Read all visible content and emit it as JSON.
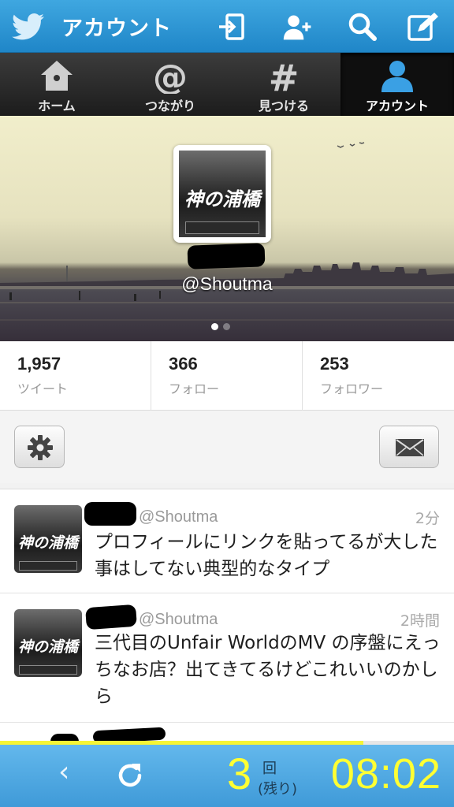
{
  "header": {
    "title": "アカウント",
    "icons": [
      "twitter-bird-icon",
      "sign-in-icon",
      "add-user-icon",
      "search-icon",
      "compose-icon"
    ]
  },
  "tabs": [
    {
      "label": "ホーム",
      "icon": "home-icon",
      "active": false
    },
    {
      "label": "つながり",
      "icon": "at-icon",
      "active": false
    },
    {
      "label": "見つける",
      "icon": "hash-icon",
      "active": false
    },
    {
      "label": "アカウント",
      "icon": "user-icon",
      "active": true
    }
  ],
  "profile": {
    "handle": "@Shoutma",
    "avatar_text": "神の浦橋",
    "page_indicator": {
      "pages": 2,
      "current": 1
    }
  },
  "stats": [
    {
      "value": "1,957",
      "label": "ツイート"
    },
    {
      "value": "366",
      "label": "フォロー"
    },
    {
      "value": "253",
      "label": "フォロワー"
    }
  ],
  "actions": {
    "settings_icon": "gear-icon",
    "message_icon": "envelope-icon"
  },
  "tweets": [
    {
      "handle": "@Shoutma",
      "time": "2分",
      "text": "プロフィールにリンクを貼ってるが大した事はしてない典型的なタイプ"
    },
    {
      "handle": "@Shoutma",
      "time": "2時間",
      "text": "三代目のUnfair WorldのMV の序盤にえっちなお店？出てきてるけどこれいいのかしら"
    }
  ],
  "bottom": {
    "back_icon": "chevron-left-icon",
    "reload_icon": "reload-icon",
    "count": "3",
    "count_unit": "回",
    "count_note": "(残り)",
    "clock": "08:02",
    "progress": 0.8
  },
  "colors": {
    "header_blue": "#2a93d5",
    "accent_yellow": "#ffff33",
    "tab_active_icon": "#3aa0e4"
  }
}
